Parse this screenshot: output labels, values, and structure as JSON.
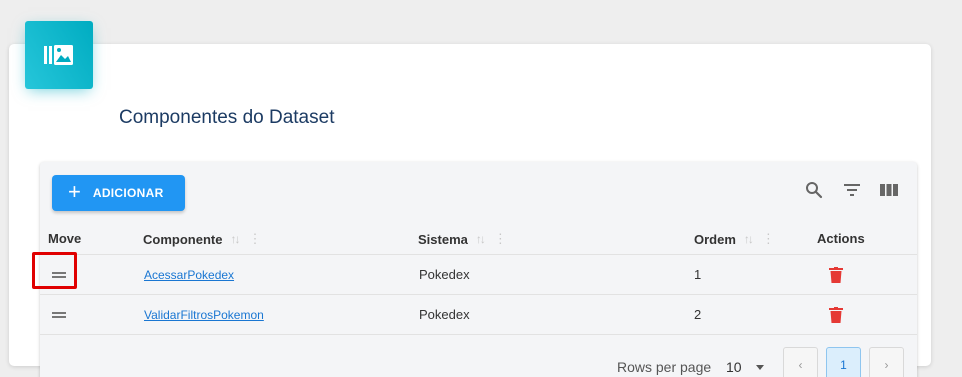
{
  "card": {
    "title": "Componentes do Dataset",
    "icon": "library-image-icon"
  },
  "toolbar": {
    "add_label": "ADICIONAR",
    "search_icon": "search-icon",
    "filter_icon": "filter-icon",
    "columns_icon": "columns-icon"
  },
  "table": {
    "headers": {
      "move": "Move",
      "componente": "Componente",
      "sistema": "Sistema",
      "ordem": "Ordem",
      "actions": "Actions"
    },
    "rows": [
      {
        "componente": "AcessarPokedex",
        "sistema": "Pokedex",
        "ordem": "1"
      },
      {
        "componente": "ValidarFiltrosPokemon",
        "sistema": "Pokedex",
        "ordem": "2"
      }
    ]
  },
  "pagination": {
    "rows_per_page_label": "Rows per page",
    "rows_per_page_value": "10",
    "current_page": "1",
    "prev": "‹",
    "next": "›"
  },
  "colors": {
    "accent": "#2196f3",
    "icon_bg": "#00acc1",
    "title": "#1c3b63",
    "delete": "#e53935",
    "highlight": "#e00000"
  }
}
